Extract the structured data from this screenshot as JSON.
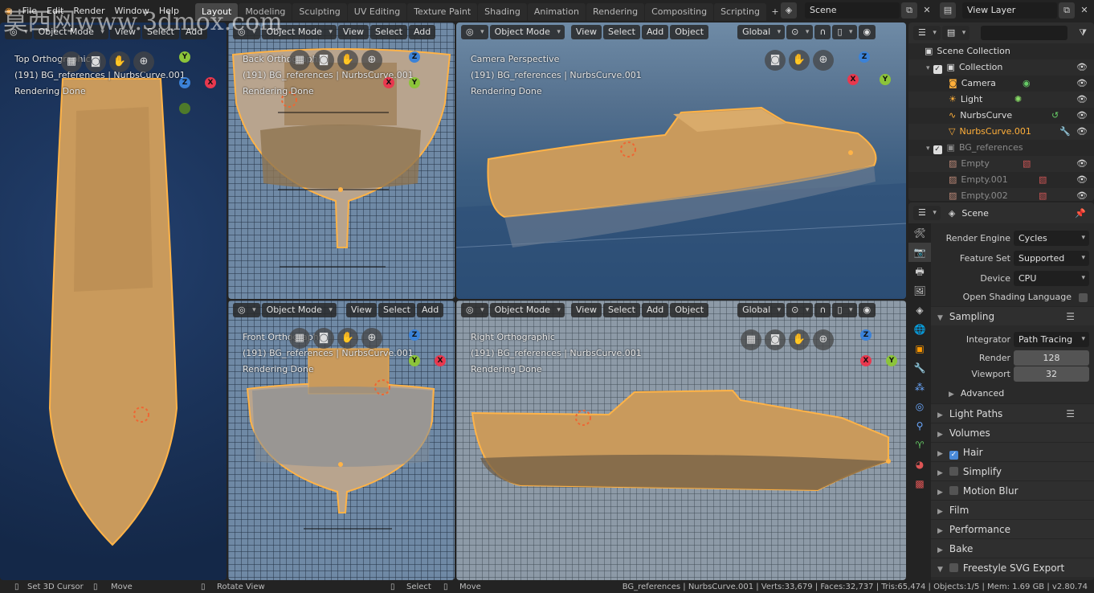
{
  "topbar": {
    "menus": [
      "File",
      "Edit",
      "Render",
      "Window",
      "Help"
    ],
    "workspaces": [
      "Layout",
      "Modeling",
      "Sculpting",
      "UV Editing",
      "Texture Paint",
      "Shading",
      "Animation",
      "Rendering",
      "Compositing",
      "Scripting"
    ],
    "active_workspace": "Layout",
    "scene": "Scene",
    "view_layer": "View Layer"
  },
  "watermark": "莫西网www.3dmox.com",
  "viewports": {
    "top": {
      "mode": "Object Mode",
      "menus": [
        "View",
        "Select",
        "Add"
      ],
      "name": "Top Orthographic",
      "info": "(191) BG_references | NurbsCurve.001",
      "status": "Rendering Done"
    },
    "back": {
      "mode": "Object Mode",
      "menus": [
        "View",
        "Select",
        "Add"
      ],
      "name": "Back Orthographic",
      "info": "(191) BG_references | NurbsCurve.001",
      "status": "Rendering Done"
    },
    "camera": {
      "mode": "Object Mode",
      "menus": [
        "View",
        "Select",
        "Add",
        "Object"
      ],
      "orientation": "Global",
      "name": "Camera Perspective",
      "info": "(191) BG_references | NurbsCurve.001",
      "status": "Rendering Done"
    },
    "front": {
      "mode": "Object Mode",
      "menus": [
        "View",
        "Select",
        "Add"
      ],
      "name": "Front Orthographic",
      "info": "(191) BG_references | NurbsCurve.001",
      "status": "Rendering Done"
    },
    "right": {
      "mode": "Object Mode",
      "menus": [
        "View",
        "Select",
        "Add",
        "Object"
      ],
      "orientation": "Global",
      "name": "Right Orthographic",
      "info": "(191) BG_references | NurbsCurve.001",
      "status": "Rendering Done"
    }
  },
  "gizmo": {
    "x": "X",
    "y": "Y",
    "z": "Z"
  },
  "outliner": {
    "search_placeholder": "",
    "rows": [
      {
        "label": "Scene Collection",
        "indent": 0
      },
      {
        "label": "Collection",
        "indent": 1
      },
      {
        "label": "Camera",
        "indent": 2
      },
      {
        "label": "Light",
        "indent": 2
      },
      {
        "label": "NurbsCurve",
        "indent": 2
      },
      {
        "label": "NurbsCurve.001",
        "indent": 2
      },
      {
        "label": "BG_references",
        "indent": 1
      },
      {
        "label": "Empty",
        "indent": 2
      },
      {
        "label": "Empty.001",
        "indent": 2
      },
      {
        "label": "Empty.002",
        "indent": 2
      }
    ]
  },
  "properties": {
    "context": "Scene",
    "render_engine_label": "Render Engine",
    "render_engine": "Cycles",
    "feature_set_label": "Feature Set",
    "feature_set": "Supported",
    "device_label": "Device",
    "device": "CPU",
    "osl_label": "Open Shading Language",
    "sampling": "Sampling",
    "integrator_label": "Integrator",
    "integrator": "Path Tracing",
    "render_label": "Render",
    "render_samples": "128",
    "viewport_label": "Viewport",
    "viewport_samples": "32",
    "advanced": "Advanced",
    "panels": [
      "Light Paths",
      "Volumes",
      "Hair",
      "Simplify",
      "Motion Blur",
      "Film",
      "Performance",
      "Bake",
      "Freestyle SVG Export"
    ]
  },
  "statusbar": {
    "set_cursor": "Set 3D Cursor",
    "move1": "Move",
    "rotate": "Rotate View",
    "select": "Select",
    "move2": "Move",
    "stats": "BG_references | NurbsCurve.001 | Verts:33,679 | Faces:32,737 | Tris:65,474 | Objects:1/5 | Mem: 1.69 GB | v2.80.74"
  },
  "colors": {
    "accent": "#ffaf3a",
    "active_tab": "#474747",
    "hull": "#c99a5c",
    "axis_x": "#e8384e",
    "axis_y": "#8cc43a",
    "axis_z": "#3b82d8"
  }
}
